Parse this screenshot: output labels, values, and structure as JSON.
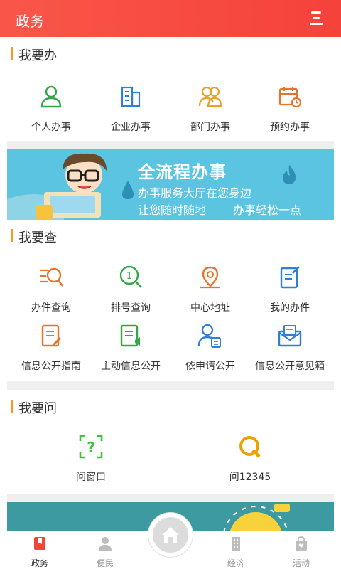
{
  "header": {
    "title": "政务"
  },
  "sections": {
    "do": {
      "title": "我要办",
      "items": [
        "个人办事",
        "企业办事",
        "部门办事",
        "预约办事"
      ]
    },
    "check": {
      "title": "我要查",
      "row1": [
        "办件查询",
        "排号查询",
        "中心地址",
        "我的办件"
      ],
      "row2": [
        "信息公开指南",
        "主动信息公开",
        "依申请公开",
        "信息公开意见箱"
      ]
    },
    "ask": {
      "title": "我要问",
      "items": [
        "问窗口",
        "问12345"
      ]
    }
  },
  "banner": {
    "headline": "全流程办事",
    "line1": "办事服务大厅在您身边",
    "line2a": "让您随时随地",
    "line2b": "办事轻松一点"
  },
  "tabs": [
    "政务",
    "便民",
    "经济",
    "活动"
  ],
  "colors": {
    "accent": "#f5423a",
    "section_bar": "#f59a23",
    "green": "#2fa846",
    "blue": "#2f7fd6",
    "orange": "#e8742a",
    "banner_bg": "#5bc4e0"
  }
}
